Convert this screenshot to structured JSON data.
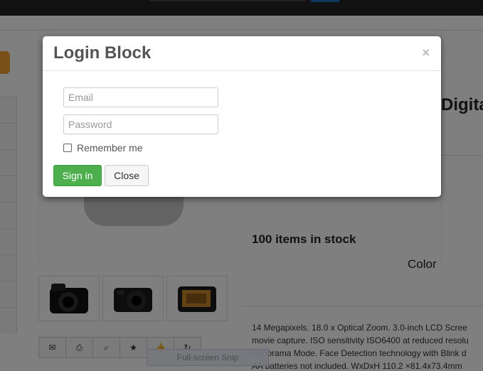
{
  "modal": {
    "title": "Login Block",
    "close_icon": "×",
    "email_placeholder": "Email",
    "password_placeholder": "Password",
    "remember_label": "Remember me",
    "signin_label": "Sign in",
    "close_label": "Close"
  },
  "product": {
    "title_fragment": "Digita",
    "stock": "100 items in stock",
    "color_label": "Color",
    "description_lines": [
      "14 Megapixels. 18.0 x Optical Zoom. 3.0-inch LCD Scree",
      "movie capture. ISO sensitivity ISO6400 at reduced resolu",
      "Panorama Mode. Face Detection technology with Blink d",
      "AA batteries not included. WxDxH 110.2 ×81.4x73.4mm"
    ]
  },
  "toolbar": {
    "icons": [
      "envelope-icon",
      "print-icon",
      "zoom-icon",
      "star-icon",
      "thumbs-up-icon",
      "share-icon"
    ],
    "glyphs": [
      "✉",
      "⎙",
      "⌕",
      "★",
      "👍",
      "↻"
    ]
  },
  "overlay": {
    "snip_label": "Full-screen Snip"
  }
}
